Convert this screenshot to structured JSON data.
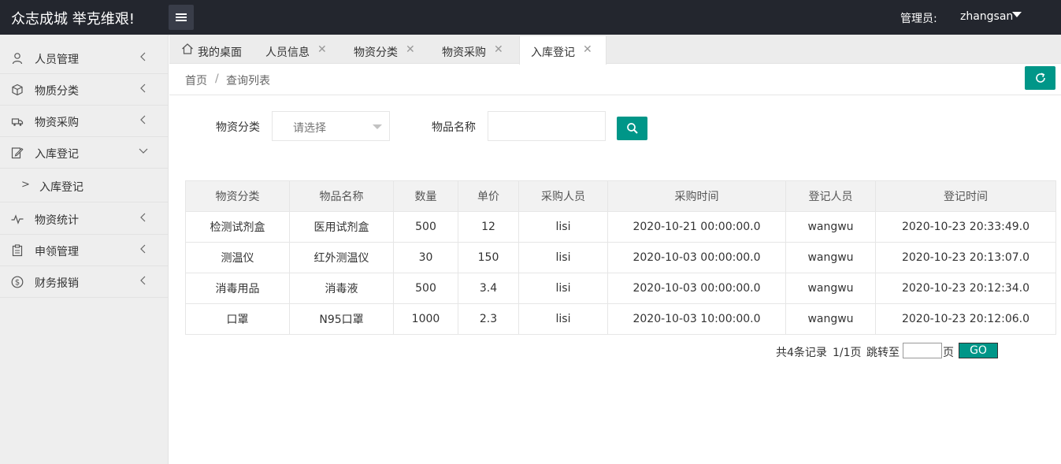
{
  "header": {
    "logo": "众志成城 举克维艰!",
    "admin_label": "管理员:",
    "admin_name": "zhangsan"
  },
  "sidebar": {
    "items": [
      {
        "label": "人员管理",
        "icon": "user-icon"
      },
      {
        "label": "物质分类",
        "icon": "cube-icon"
      },
      {
        "label": "物资采购",
        "icon": "truck-icon"
      },
      {
        "label": "入库登记",
        "icon": "edit-icon",
        "expanded": true
      },
      {
        "label": "物资统计",
        "icon": "pulse-icon"
      },
      {
        "label": "申领管理",
        "icon": "clipboard-icon"
      },
      {
        "label": "财务报销",
        "icon": "dollar-icon"
      }
    ],
    "sub_items": [
      {
        "label": "入库登记",
        "arrow": ">"
      }
    ]
  },
  "tabs": [
    {
      "label": "我的桌面",
      "icon": "home-icon",
      "closable": false
    },
    {
      "label": "人员信息",
      "closable": true
    },
    {
      "label": "物资分类",
      "closable": true
    },
    {
      "label": "物资采购",
      "closable": true
    },
    {
      "label": "入库登记",
      "closable": true,
      "active": true
    }
  ],
  "breadcrumb": {
    "home": "首页",
    "separator": "/",
    "current": "查询列表"
  },
  "search": {
    "category_label": "物资分类",
    "category_placeholder": "请选择",
    "name_label": "物品名称",
    "name_value": ""
  },
  "table": {
    "headers": [
      "物资分类",
      "物品名称",
      "数量",
      "单价",
      "采购人员",
      "采购时间",
      "登记人员",
      "登记时间"
    ],
    "rows": [
      [
        "检测试剂盒",
        "医用试剂盒",
        "500",
        "12",
        "lisi",
        "2020-10-21 00:00:00.0",
        "wangwu",
        "2020-10-23 20:33:49.0"
      ],
      [
        "测温仪",
        "红外测温仪",
        "30",
        "150",
        "lisi",
        "2020-10-03 00:00:00.0",
        "wangwu",
        "2020-10-23 20:13:07.0"
      ],
      [
        "消毒用品",
        "消毒液",
        "500",
        "3.4",
        "lisi",
        "2020-10-03 00:00:00.0",
        "wangwu",
        "2020-10-23 20:12:34.0"
      ],
      [
        "口罩",
        "N95口罩",
        "1000",
        "2.3",
        "lisi",
        "2020-10-03 10:00:00.0",
        "wangwu",
        "2020-10-23 20:12:06.0"
      ]
    ]
  },
  "pager": {
    "total": "共4条记录",
    "pages": "1/1页",
    "jump_to": "跳转至",
    "page_suffix": "页",
    "go": "GO",
    "page_value": ""
  },
  "colors": {
    "header_bg": "#23262e",
    "accent": "#009688",
    "sidebar_bg": "#eeeeee"
  }
}
